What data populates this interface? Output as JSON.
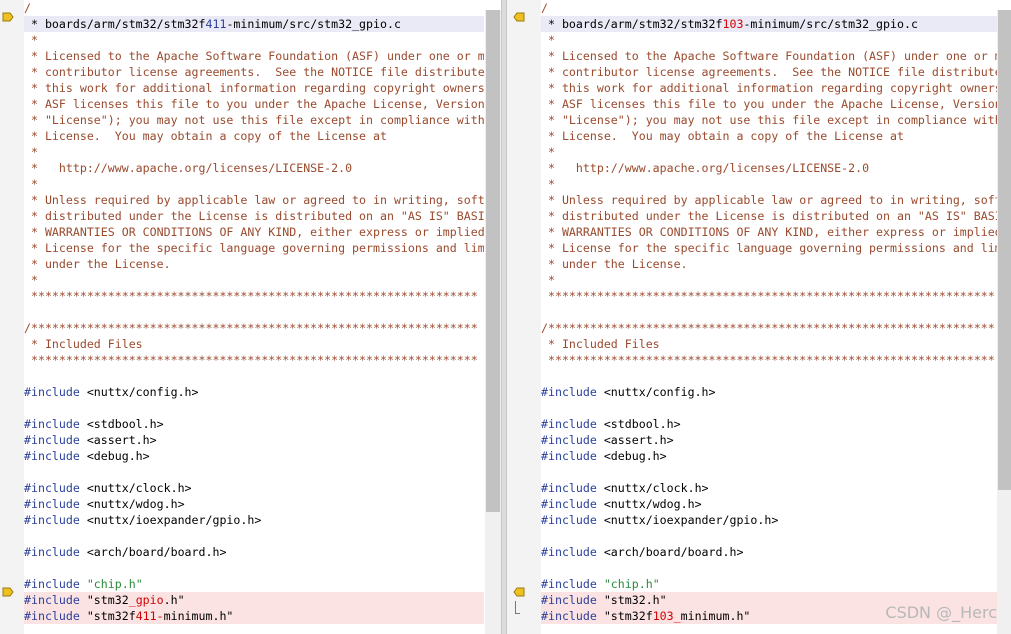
{
  "left_pane": {
    "file_path": "boards/arm/stm32/stm32f411-minimum/src/stm32_gpio.c",
    "lines": [
      {
        "segments": [
          {
            "text": "/",
            "cls": "tok-comment"
          }
        ]
      },
      {
        "hl": "blue",
        "segments": [
          {
            "text": " * boards/arm/stm32/stm32f",
            "cls": ""
          },
          {
            "text": "411",
            "cls": "tok-pre"
          },
          {
            "text": "-minimum/src/stm32_gpio.c",
            "cls": ""
          }
        ]
      },
      {
        "segments": [
          {
            "text": " *",
            "cls": "tok-comment"
          }
        ]
      },
      {
        "segments": [
          {
            "text": " * Licensed to the Apache Software Foundation (ASF) under one or m",
            "cls": "tok-comment"
          }
        ]
      },
      {
        "segments": [
          {
            "text": " * contributor license agreements.  See the NOTICE file distribute",
            "cls": "tok-comment"
          }
        ]
      },
      {
        "segments": [
          {
            "text": " * this work for additional information regarding copyright owners",
            "cls": "tok-comment"
          }
        ]
      },
      {
        "segments": [
          {
            "text": " * ASF licenses this file to you under the Apache License, Version",
            "cls": "tok-comment"
          }
        ]
      },
      {
        "segments": [
          {
            "text": " * \"License\"); you may not use this file except in compliance with",
            "cls": "tok-comment"
          }
        ]
      },
      {
        "segments": [
          {
            "text": " * License.  You may obtain a copy of the License at",
            "cls": "tok-comment"
          }
        ]
      },
      {
        "segments": [
          {
            "text": " *",
            "cls": "tok-comment"
          }
        ]
      },
      {
        "segments": [
          {
            "text": " *   http://www.apache.org/licenses/LICENSE-2.0",
            "cls": "tok-comment"
          }
        ]
      },
      {
        "segments": [
          {
            "text": " *",
            "cls": "tok-comment"
          }
        ]
      },
      {
        "segments": [
          {
            "text": " * Unless required by applicable law or agreed to in writing, soft",
            "cls": "tok-comment"
          }
        ]
      },
      {
        "segments": [
          {
            "text": " * distributed under the License is distributed on an \"AS IS\" BASI",
            "cls": "tok-comment"
          }
        ]
      },
      {
        "segments": [
          {
            "text": " * WARRANTIES OR CONDITIONS OF ANY KIND, either express or implied",
            "cls": "tok-comment"
          }
        ]
      },
      {
        "segments": [
          {
            "text": " * License for the specific language governing permissions and lim",
            "cls": "tok-comment"
          }
        ]
      },
      {
        "segments": [
          {
            "text": " * under the License.",
            "cls": "tok-comment"
          }
        ]
      },
      {
        "segments": [
          {
            "text": " *",
            "cls": "tok-comment"
          }
        ]
      },
      {
        "segments": [
          {
            "text": " ****************************************************************",
            "cls": "tok-comment"
          }
        ]
      },
      {
        "segments": []
      },
      {
        "segments": [
          {
            "text": "/****************************************************************",
            "cls": "tok-comment"
          }
        ]
      },
      {
        "segments": [
          {
            "text": " * Included Files",
            "cls": "tok-comment"
          }
        ]
      },
      {
        "segments": [
          {
            "text": " ****************************************************************",
            "cls": "tok-comment"
          }
        ]
      },
      {
        "segments": []
      },
      {
        "segments": [
          {
            "text": "#include",
            "cls": "tok-pre"
          },
          {
            "text": " <nuttx/config.h>",
            "cls": ""
          }
        ]
      },
      {
        "segments": []
      },
      {
        "segments": [
          {
            "text": "#include",
            "cls": "tok-pre"
          },
          {
            "text": " <stdbool.h>",
            "cls": ""
          }
        ]
      },
      {
        "segments": [
          {
            "text": "#include",
            "cls": "tok-pre"
          },
          {
            "text": " <assert.h>",
            "cls": ""
          }
        ]
      },
      {
        "segments": [
          {
            "text": "#include",
            "cls": "tok-pre"
          },
          {
            "text": " <debug.h>",
            "cls": ""
          }
        ]
      },
      {
        "segments": []
      },
      {
        "segments": [
          {
            "text": "#include",
            "cls": "tok-pre"
          },
          {
            "text": " <nuttx/clock.h>",
            "cls": ""
          }
        ]
      },
      {
        "segments": [
          {
            "text": "#include",
            "cls": "tok-pre"
          },
          {
            "text": " <nuttx/wdog.h>",
            "cls": ""
          }
        ]
      },
      {
        "segments": [
          {
            "text": "#include",
            "cls": "tok-pre"
          },
          {
            "text": " <nuttx/ioexpander/gpio.h>",
            "cls": ""
          }
        ]
      },
      {
        "segments": []
      },
      {
        "segments": [
          {
            "text": "#include",
            "cls": "tok-pre"
          },
          {
            "text": " <arch/board/board.h>",
            "cls": ""
          }
        ]
      },
      {
        "segments": []
      },
      {
        "segments": [
          {
            "text": "#include",
            "cls": "tok-pre"
          },
          {
            "text": " ",
            "cls": ""
          },
          {
            "text": "\"chip.h\"",
            "cls": "tok-str"
          }
        ]
      },
      {
        "hl": "red",
        "segments": [
          {
            "text": "#include",
            "cls": "tok-pre"
          },
          {
            "text": " \"stm32",
            "cls": ""
          },
          {
            "text": "_gpio",
            "cls": "tok-diff"
          },
          {
            "text": ".h\"",
            "cls": ""
          }
        ]
      },
      {
        "hl": "red",
        "segments": [
          {
            "text": "#include",
            "cls": "tok-pre"
          },
          {
            "text": " \"stm32f",
            "cls": ""
          },
          {
            "text": "411-",
            "cls": "tok-diff"
          },
          {
            "text": "minimum.h\"",
            "cls": ""
          }
        ]
      }
    ]
  },
  "right_pane": {
    "file_path": "boards/arm/stm32/stm32f103-minimum/src/stm32_gpio.c",
    "lines": [
      {
        "segments": [
          {
            "text": "/",
            "cls": "tok-comment"
          }
        ]
      },
      {
        "hl": "blue",
        "segments": [
          {
            "text": " * boards/arm/stm32/stm32f",
            "cls": ""
          },
          {
            "text": "103",
            "cls": "tok-diff"
          },
          {
            "text": "-minimum/src/stm32_gpio.c",
            "cls": ""
          }
        ]
      },
      {
        "segments": [
          {
            "text": " *",
            "cls": "tok-comment"
          }
        ]
      },
      {
        "segments": [
          {
            "text": " * Licensed to the Apache Software Foundation (ASF) under one or m",
            "cls": "tok-comment"
          }
        ]
      },
      {
        "segments": [
          {
            "text": " * contributor license agreements.  See the NOTICE file distribute",
            "cls": "tok-comment"
          }
        ]
      },
      {
        "segments": [
          {
            "text": " * this work for additional information regarding copyright owners",
            "cls": "tok-comment"
          }
        ]
      },
      {
        "segments": [
          {
            "text": " * ASF licenses this file to you under the Apache License, Version",
            "cls": "tok-comment"
          }
        ]
      },
      {
        "segments": [
          {
            "text": " * \"License\"); you may not use this file except in compliance with",
            "cls": "tok-comment"
          }
        ]
      },
      {
        "segments": [
          {
            "text": " * License.  You may obtain a copy of the License at",
            "cls": "tok-comment"
          }
        ]
      },
      {
        "segments": [
          {
            "text": " *",
            "cls": "tok-comment"
          }
        ]
      },
      {
        "segments": [
          {
            "text": " *   http://www.apache.org/licenses/LICENSE-2.0",
            "cls": "tok-comment"
          }
        ]
      },
      {
        "segments": [
          {
            "text": " *",
            "cls": "tok-comment"
          }
        ]
      },
      {
        "segments": [
          {
            "text": " * Unless required by applicable law or agreed to in writing, soft",
            "cls": "tok-comment"
          }
        ]
      },
      {
        "segments": [
          {
            "text": " * distributed under the License is distributed on an \"AS IS\" BASI",
            "cls": "tok-comment"
          }
        ]
      },
      {
        "segments": [
          {
            "text": " * WARRANTIES OR CONDITIONS OF ANY KIND, either express or implied",
            "cls": "tok-comment"
          }
        ]
      },
      {
        "segments": [
          {
            "text": " * License for the specific language governing permissions and lim",
            "cls": "tok-comment"
          }
        ]
      },
      {
        "segments": [
          {
            "text": " * under the License.",
            "cls": "tok-comment"
          }
        ]
      },
      {
        "segments": [
          {
            "text": " *",
            "cls": "tok-comment"
          }
        ]
      },
      {
        "segments": [
          {
            "text": " ****************************************************************",
            "cls": "tok-comment"
          }
        ]
      },
      {
        "segments": []
      },
      {
        "segments": [
          {
            "text": "/****************************************************************",
            "cls": "tok-comment"
          }
        ]
      },
      {
        "segments": [
          {
            "text": " * Included Files",
            "cls": "tok-comment"
          }
        ]
      },
      {
        "segments": [
          {
            "text": " ****************************************************************",
            "cls": "tok-comment"
          }
        ]
      },
      {
        "segments": []
      },
      {
        "segments": [
          {
            "text": "#include",
            "cls": "tok-pre"
          },
          {
            "text": " <nuttx/config.h>",
            "cls": ""
          }
        ]
      },
      {
        "segments": []
      },
      {
        "segments": [
          {
            "text": "#include",
            "cls": "tok-pre"
          },
          {
            "text": " <stdbool.h>",
            "cls": ""
          }
        ]
      },
      {
        "segments": [
          {
            "text": "#include",
            "cls": "tok-pre"
          },
          {
            "text": " <assert.h>",
            "cls": ""
          }
        ]
      },
      {
        "segments": [
          {
            "text": "#include",
            "cls": "tok-pre"
          },
          {
            "text": " <debug.h>",
            "cls": ""
          }
        ]
      },
      {
        "segments": []
      },
      {
        "segments": [
          {
            "text": "#include",
            "cls": "tok-pre"
          },
          {
            "text": " <nuttx/clock.h>",
            "cls": ""
          }
        ]
      },
      {
        "segments": [
          {
            "text": "#include",
            "cls": "tok-pre"
          },
          {
            "text": " <nuttx/wdog.h>",
            "cls": ""
          }
        ]
      },
      {
        "segments": [
          {
            "text": "#include",
            "cls": "tok-pre"
          },
          {
            "text": " <nuttx/ioexpander/gpio.h>",
            "cls": ""
          }
        ]
      },
      {
        "segments": []
      },
      {
        "segments": [
          {
            "text": "#include",
            "cls": "tok-pre"
          },
          {
            "text": " <arch/board/board.h>",
            "cls": ""
          }
        ]
      },
      {
        "segments": []
      },
      {
        "segments": [
          {
            "text": "#include",
            "cls": "tok-pre"
          },
          {
            "text": " ",
            "cls": ""
          },
          {
            "text": "\"chip.h\"",
            "cls": "tok-str"
          }
        ]
      },
      {
        "hl": "red",
        "segments": [
          {
            "text": "#include",
            "cls": "tok-pre"
          },
          {
            "text": " \"stm32.h\"",
            "cls": ""
          }
        ]
      },
      {
        "hl": "red",
        "segments": [
          {
            "text": "#include",
            "cls": "tok-pre"
          },
          {
            "text": " \"stm32f",
            "cls": ""
          },
          {
            "text": "103_",
            "cls": "tok-diff"
          },
          {
            "text": "minimum.h\"",
            "cls": ""
          }
        ]
      }
    ]
  },
  "markers": {
    "left_icon": "arrow-right-icon",
    "right_icon": "arrow-left-icon",
    "color": "#f0c020"
  },
  "colors": {
    "comment": "#9a4a2d",
    "preprocessor": "#2a3f9a",
    "string": "#2a8a3c",
    "diff_change": "#d40000",
    "highlight_changed_line": "#fbe3e3",
    "highlight_current_line": "#eaeaf7"
  },
  "watermark": "CSDN @_Herc"
}
